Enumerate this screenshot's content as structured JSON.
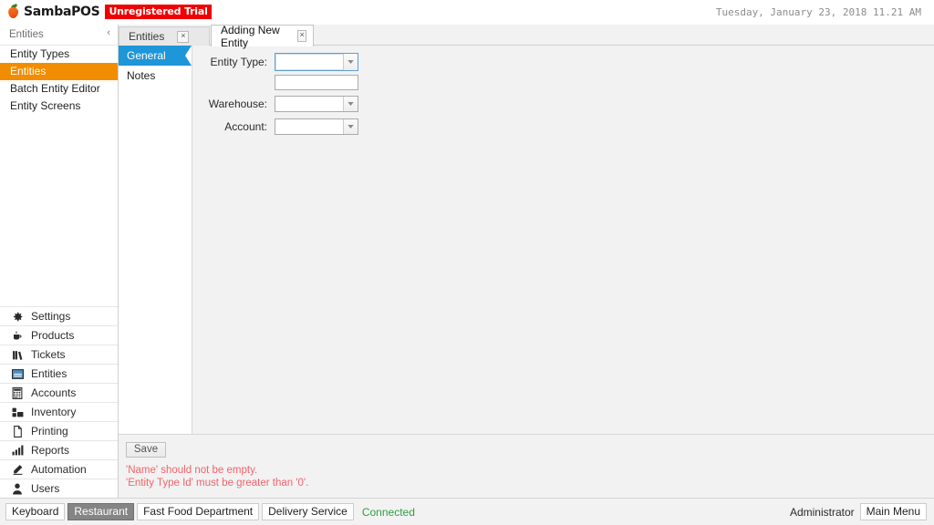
{
  "app": {
    "name": "SambaPOS",
    "trial_badge": "Unregistered Trial",
    "datetime": "Tuesday, January 23, 2018 11.21 AM",
    "logo_icon": "pepper-icon"
  },
  "sidebar": {
    "header": "Entities",
    "collapse_icon": "‹",
    "items": [
      {
        "label": "Entity Types",
        "selected": false
      },
      {
        "label": "Entities",
        "selected": true
      },
      {
        "label": "Batch Entity Editor",
        "selected": false
      },
      {
        "label": "Entity Screens",
        "selected": false
      }
    ],
    "modules": [
      {
        "label": "Settings",
        "icon": "gear-icon"
      },
      {
        "label": "Products",
        "icon": "cup-icon"
      },
      {
        "label": "Tickets",
        "icon": "books-icon"
      },
      {
        "label": "Entities",
        "icon": "card-icon"
      },
      {
        "label": "Accounts",
        "icon": "calculator-icon"
      },
      {
        "label": "Inventory",
        "icon": "boxes-icon"
      },
      {
        "label": "Printing",
        "icon": "page-icon"
      },
      {
        "label": "Reports",
        "icon": "bar-chart-icon"
      },
      {
        "label": "Automation",
        "icon": "pencil-icon"
      },
      {
        "label": "Users",
        "icon": "person-icon"
      }
    ]
  },
  "tabs": [
    {
      "label": "Entities",
      "active": false,
      "close_glyph": "×"
    },
    {
      "label": "Adding New Entity",
      "active": true,
      "close_glyph": "×"
    }
  ],
  "vertical_tabs": [
    {
      "label": "General",
      "active": true
    },
    {
      "label": "Notes",
      "active": false
    }
  ],
  "form": {
    "fields": [
      {
        "label": "Entity Type:",
        "type": "combobox",
        "value": "",
        "focused": true
      },
      {
        "label": "",
        "type": "textbox",
        "value": ""
      },
      {
        "label": "Warehouse:",
        "type": "combobox",
        "value": "",
        "focused": false
      },
      {
        "label": "Account:",
        "type": "combobox",
        "value": "",
        "focused": false
      }
    ]
  },
  "actions": {
    "save_label": "Save",
    "validation_messages": [
      "'Name' should not be empty.",
      "'Entity Type Id' must be greater than '0'."
    ]
  },
  "statusbar": {
    "buttons": [
      {
        "label": "Keyboard",
        "active": false
      },
      {
        "label": "Restaurant",
        "active": true
      },
      {
        "label": "Fast Food Department",
        "active": false
      },
      {
        "label": "Delivery Service",
        "active": false
      }
    ],
    "connection": "Connected",
    "user": "Administrator",
    "main_menu_label": "Main Menu"
  },
  "colors": {
    "accent_orange": "#f28c00",
    "accent_blue": "#1e96d8",
    "error_red": "#f4636a",
    "connected_green": "#2f9e44",
    "trial_red": "#f00000"
  }
}
